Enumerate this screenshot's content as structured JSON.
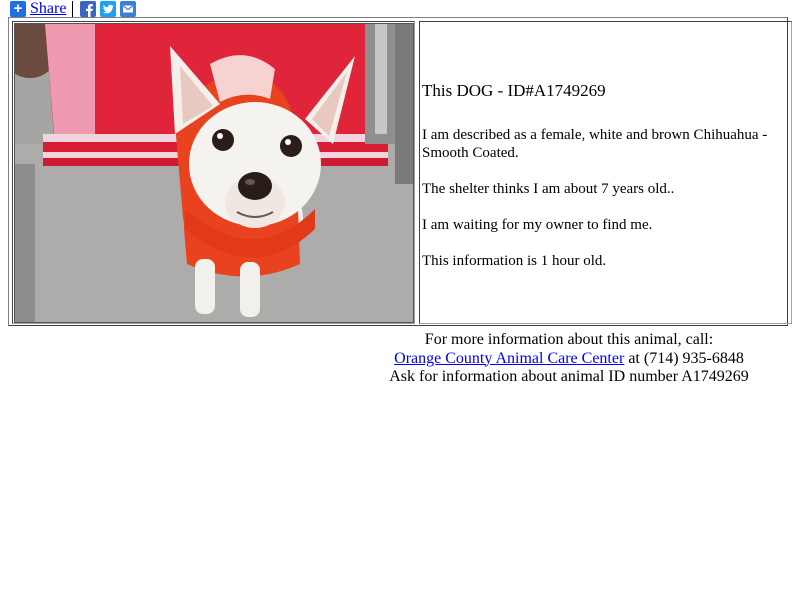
{
  "share_bar": {
    "share_label": "Share",
    "icons": [
      "plus-icon",
      "facebook-icon",
      "twitter-icon",
      "email-icon"
    ],
    "colors": {
      "plus": "#1e6ee6",
      "facebook": "#3b65c4",
      "twitter": "#1da1f2",
      "email": "#3d7fd6"
    }
  },
  "animal": {
    "title": "This DOG - ID#A1749269",
    "description": "I am described as a female, white and brown Chihuahua - Smooth Coated.",
    "age": "The shelter thinks I am about 7 years old..",
    "status": "I am waiting for my owner to find me.",
    "freshness": "This information is 1 hour old.",
    "photo_subject": "dog-photo"
  },
  "footer": {
    "line1": "For more information about this animal, call:",
    "shelter_link": "Orange County Animal Care Center",
    "phone_text": " at (714) 935-6848",
    "line3": "Ask for information about animal ID number A1749269"
  },
  "colors": {
    "link": "#0000ee",
    "sweater": "#e8431e",
    "blanket": "#e8202f"
  }
}
